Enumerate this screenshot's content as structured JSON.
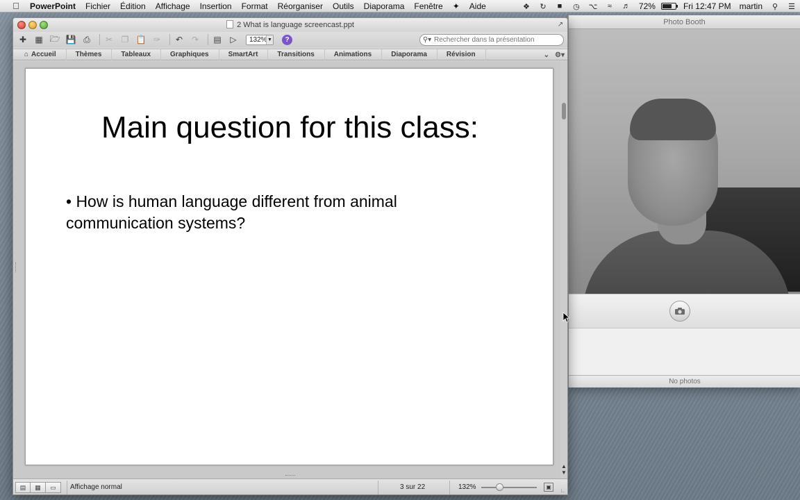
{
  "menubar": {
    "app_name": "PowerPoint",
    "items": [
      "Fichier",
      "Édition",
      "Affichage",
      "Insertion",
      "Format",
      "Réorganiser",
      "Outils",
      "Diaporama",
      "Fenêtre",
      "Aide"
    ],
    "battery": "72%",
    "battery_level": 0.72,
    "clock": "Fri 12:47 PM",
    "user": "martin"
  },
  "photobooth": {
    "title": "Photo Booth",
    "footer": "No photos"
  },
  "powerpoint": {
    "window_title": "2 What is language screencast.ppt",
    "toolbar": {
      "zoom": "132%",
      "search_placeholder": "Rechercher dans la présentation"
    },
    "ribbon_tabs": [
      "Accueil",
      "Thèmes",
      "Tableaux",
      "Graphiques",
      "SmartArt",
      "Transitions",
      "Animations",
      "Diaporama",
      "Révision"
    ],
    "slide": {
      "title": "Main question for this class:",
      "bullet": "• How is human language different from animal communication systems?"
    },
    "statusbar": {
      "view_label": "Affichage normal",
      "slide_counter": "3 sur 22",
      "zoom": "132%",
      "zoom_level": 1.32
    }
  },
  "colors": {
    "accent_help": "#7a56c9",
    "close": "#d7382c",
    "minimize": "#d99a1d",
    "maximize": "#4ba52c"
  }
}
